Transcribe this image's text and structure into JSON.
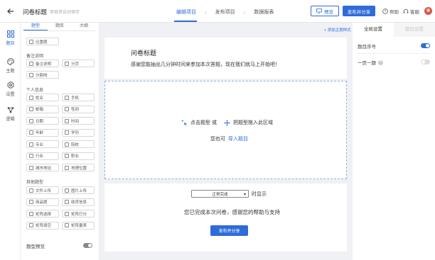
{
  "header": {
    "title": "问卷标题",
    "autosave": "项目将自动保存",
    "steps": [
      "编辑项目",
      "发布项目",
      "数据报表"
    ],
    "step_sep": "›",
    "preview_label": "预览",
    "publish_label": "发布并分享",
    "help_label": "帮助",
    "service_label": "客服"
  },
  "rail": [
    {
      "label": "题目",
      "icon": "grid-icon"
    },
    {
      "label": "主题",
      "icon": "palette-icon"
    },
    {
      "label": "设置",
      "icon": "gear-icon"
    },
    {
      "label": "逻辑",
      "icon": "logic-icon"
    }
  ],
  "panel": {
    "tabs": [
      "题型",
      "题库",
      "大纲"
    ],
    "top_chip": "比重题",
    "section_note": "备注说明",
    "note_chips": [
      "备注说明",
      "分页",
      "分割线"
    ],
    "section_personal": "个人信息",
    "personal_chips": [
      "姓名",
      "手机",
      "邮箱",
      "性别",
      "日期",
      "时间",
      "年龄",
      "学历",
      "专业",
      "院校",
      "行业",
      "职业",
      "城市地址",
      "地理位置"
    ],
    "section_other": "其他题型",
    "other_chips": [
      "文件上传",
      "图片上传",
      "商品题",
      "收货信息",
      "矩阵选择",
      "矩阵打分",
      "矩阵填空",
      "矩阵量表"
    ],
    "preview_label": "题型预览"
  },
  "canvas": {
    "add_theme": "+ 添加主题样式",
    "survey_title": "问卷标题",
    "survey_desc": "感谢您能抽出几分钟时间来参加本次答题，现在我们就马上开始吧！",
    "drop_click": "点击题型 或",
    "drop_drag": "把题型拖入此区域",
    "import_prefix": "您也可",
    "import_link": "导入题目",
    "end_select": "正常完成",
    "end_select_suffix": "时显示",
    "end_message": "您已完成本次问卷，感谢您的帮助与支持",
    "end_button": "发布并分享"
  },
  "settings": {
    "tabs": [
      "全局设置",
      "题目设置"
    ],
    "rows": [
      {
        "label": "题目序号",
        "on": true
      },
      {
        "label": "一页一题",
        "on": false
      }
    ]
  },
  "colors": {
    "accent": "#2f6bd9"
  }
}
